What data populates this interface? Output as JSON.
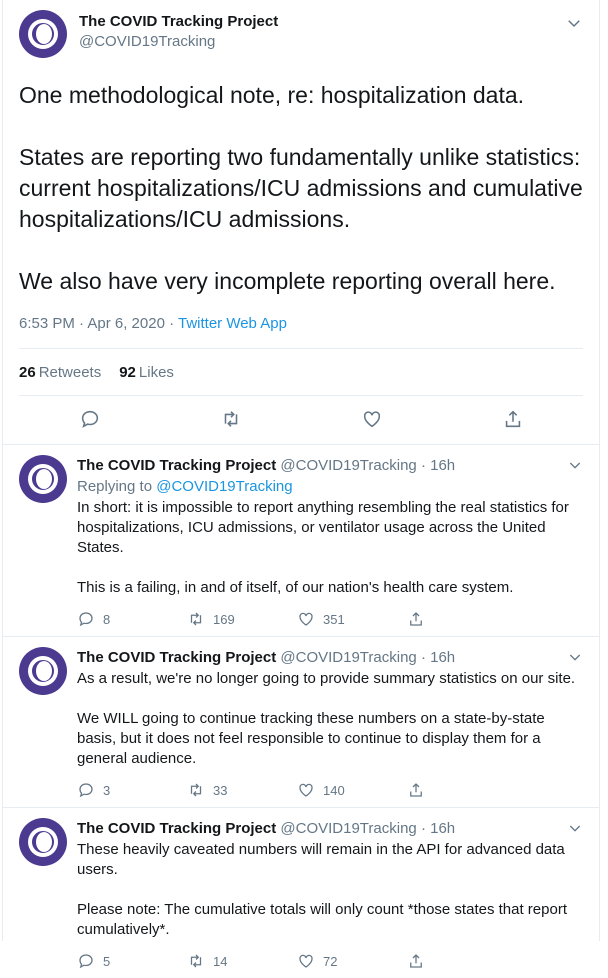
{
  "main_tweet": {
    "display_name": "The COVID Tracking Project",
    "handle": "@COVID19Tracking",
    "text": "One methodological note, re: hospitalization data.\n\nStates are reporting two fundamentally unlike statistics: current hospitalizations/ICU admissions and cumulative hospitalizations/ICU admissions.\n\nWe also have very incomplete reporting overall here.",
    "time_date": "6:53 PM · Apr 6, 2020 · ",
    "source": "Twitter Web App",
    "retweets_count": "26",
    "retweets_label": "Retweets",
    "likes_count": "92",
    "likes_label": "Likes"
  },
  "replies": [
    {
      "display_name": "The COVID Tracking Project",
      "handle": "@COVID19Tracking",
      "time": "· 16h",
      "replying_to_prefix": "Replying to ",
      "replying_to_handle": "@COVID19Tracking",
      "text": "In short: it is impossible to report anything resembling the real statistics for hospitalizations, ICU admissions, or ventilator usage across the United States.\n\nThis is a failing, in and of itself, of our nation's health care system.",
      "reply_count": "8",
      "retweet_count": "169",
      "like_count": "351"
    },
    {
      "display_name": "The COVID Tracking Project",
      "handle": "@COVID19Tracking",
      "time": "· 16h",
      "text": "As a result, we're no longer going to provide summary statistics on our site.\n\nWe WILL going to continue tracking these numbers on a state-by-state basis, but it does not feel responsible to continue to display them for a general audience.",
      "reply_count": "3",
      "retweet_count": "33",
      "like_count": "140"
    },
    {
      "display_name": "The COVID Tracking Project",
      "handle": "@COVID19Tracking",
      "time": "· 16h",
      "text": "These heavily caveated numbers will remain in the API for advanced data users.\n\nPlease note: The cumulative totals will only count *those states that report cumulatively*.",
      "reply_count": "5",
      "retweet_count": "14",
      "like_count": "72"
    }
  ],
  "icons": {
    "more": "chevron-down-icon",
    "reply": "reply-icon",
    "retweet": "retweet-icon",
    "like": "heart-icon",
    "share": "share-icon"
  },
  "colors": {
    "accent": "#1b95e0",
    "muted": "#657786",
    "avatar": "#4b3a8f"
  }
}
